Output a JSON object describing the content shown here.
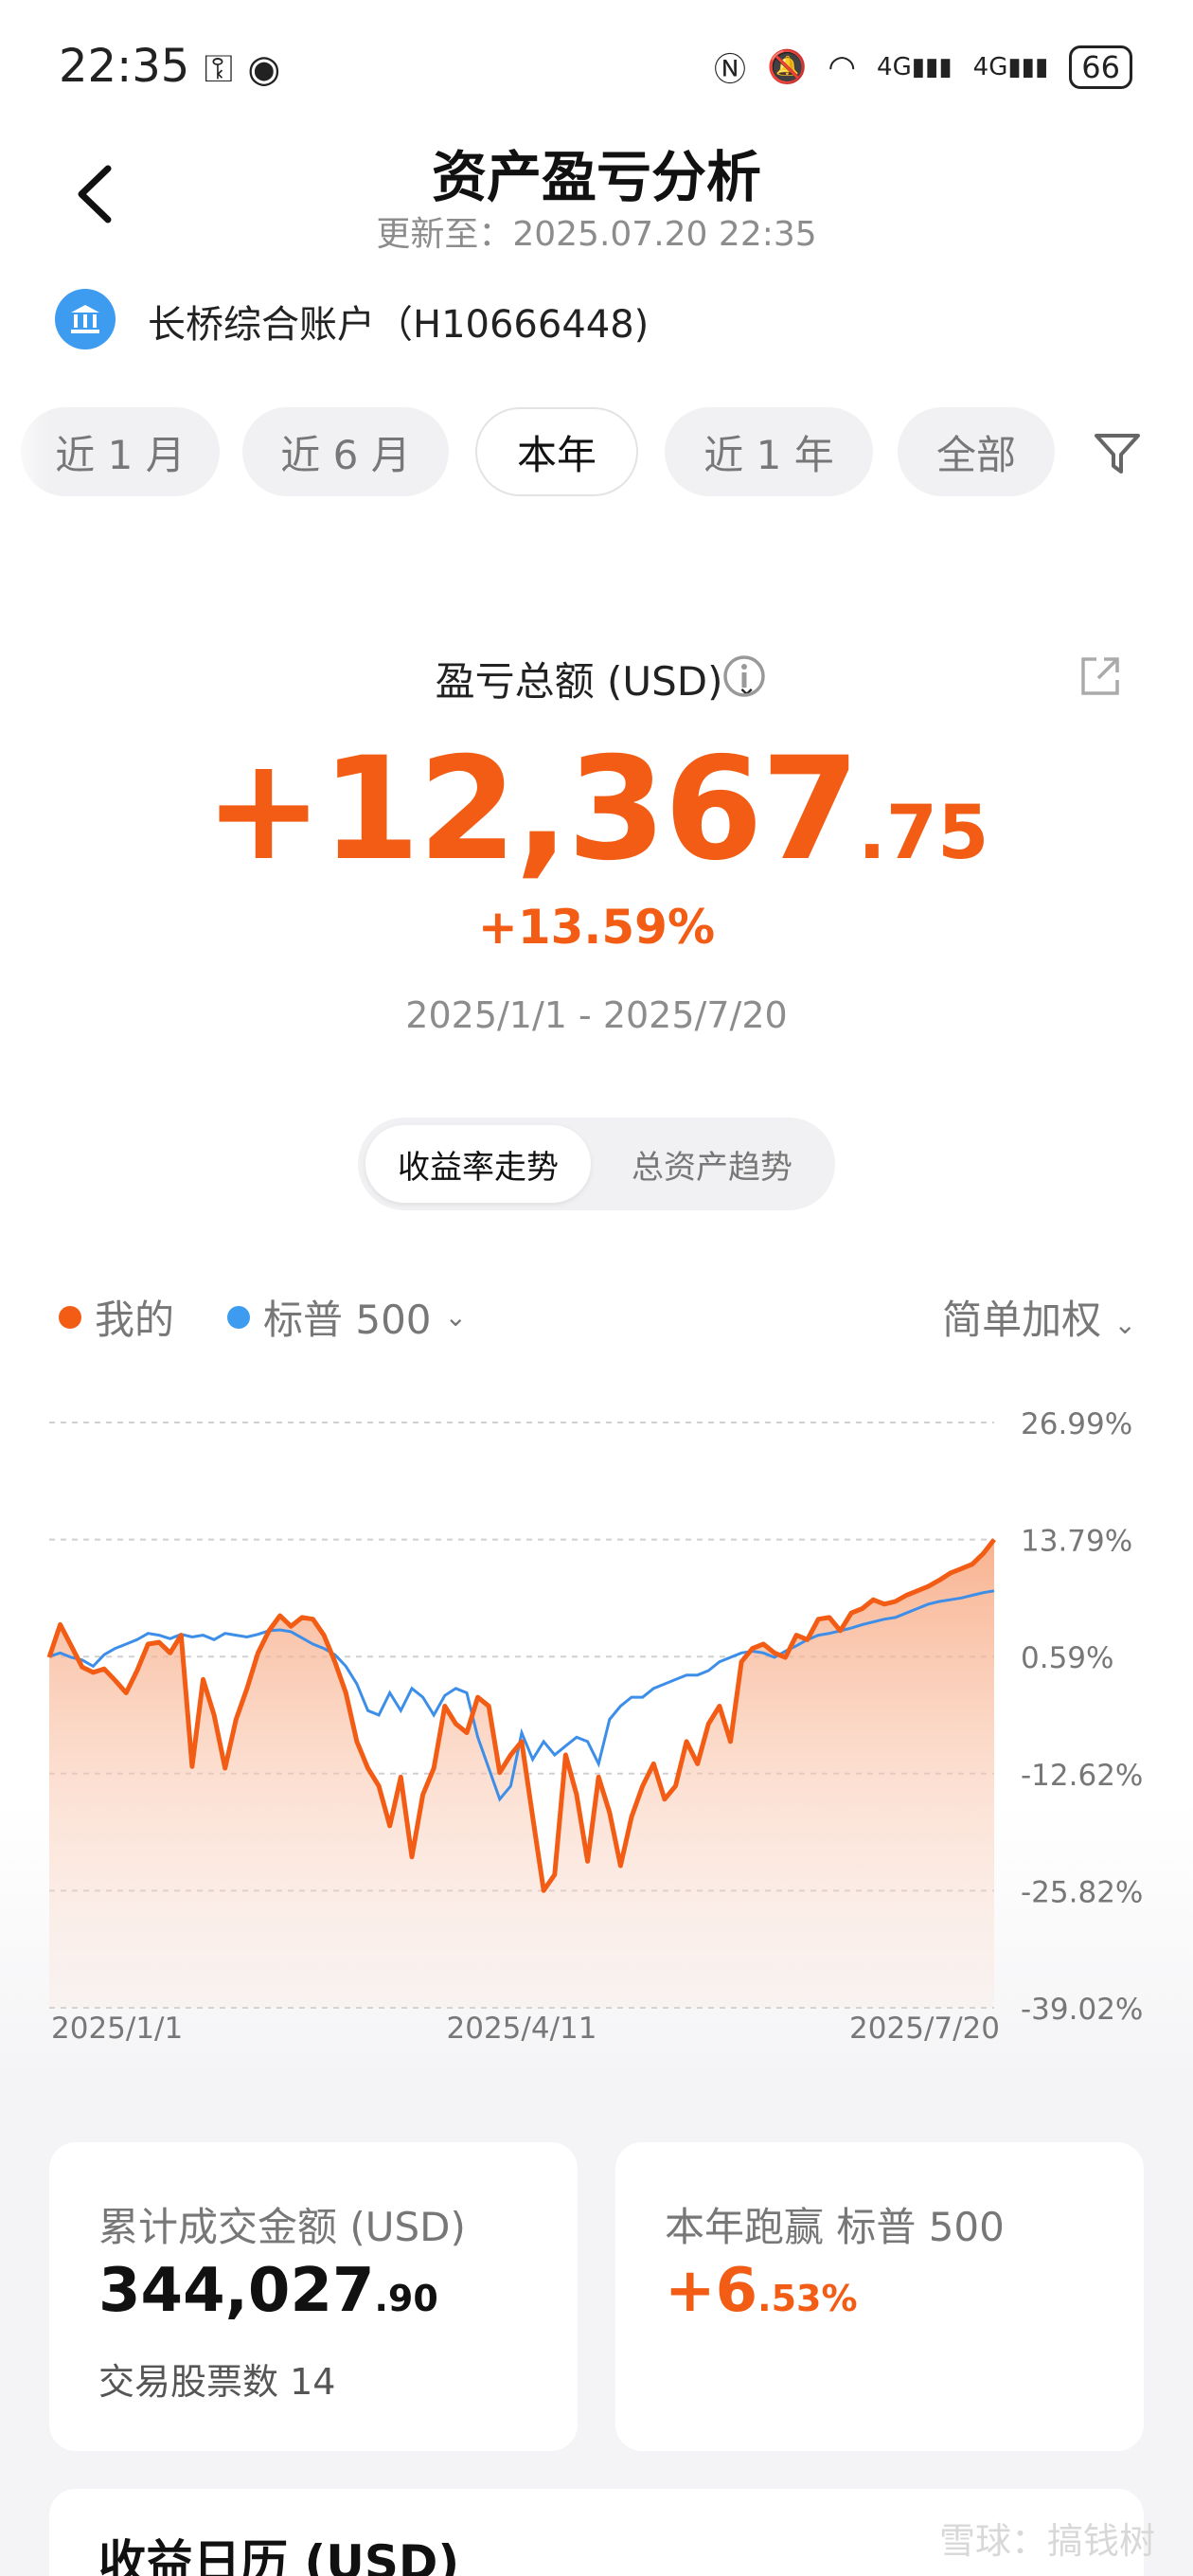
{
  "status_bar": {
    "time": "22:35",
    "icons": [
      "key-icon",
      "eye-icon",
      "nfc-icon",
      "mute-icon",
      "wifi-icon",
      "signal-4g-icon",
      "signal-4g-icon"
    ],
    "battery": "66"
  },
  "header": {
    "title": "资产盈亏分析",
    "updated": "更新至：2025.07.20 22:35"
  },
  "account": {
    "name": "长桥综合账户（H10666448)"
  },
  "period_tabs": [
    {
      "label": "近 1 月",
      "active": false
    },
    {
      "label": "近 6 月",
      "active": false
    },
    {
      "label": "本年",
      "active": true
    },
    {
      "label": "近 1 年",
      "active": false
    },
    {
      "label": "全部",
      "active": false
    }
  ],
  "summary": {
    "label": "盈亏总额 (USD)",
    "amount_int": "+12,367",
    "amount_dec": ".75",
    "percent": "+13.59%",
    "date_range": "2025/1/1 - 2025/7/20"
  },
  "chart_toggle": {
    "yield": "收益率走势",
    "assets": "总资产趋势",
    "active": "yield"
  },
  "legend": {
    "mine": "我的",
    "benchmark": "标普 500",
    "weighting": "简单加权"
  },
  "colors": {
    "accent": "#f25c14",
    "benchmark": "#3d8ee8",
    "brand_blue": "#3d9bf0"
  },
  "chart_data": {
    "type": "line",
    "ylabels": [
      "26.99%",
      "13.79%",
      "0.59%",
      "-12.62%",
      "-25.82%",
      "-39.02%"
    ],
    "ylim": [
      -39.02,
      26.99
    ],
    "xlabels": [
      "2025/1/1",
      "2025/4/11",
      "2025/7/20"
    ],
    "series": [
      {
        "name": "我的",
        "fill": true,
        "values": [
          0.5,
          4.2,
          1.8,
          -0.6,
          -1.2,
          -0.8,
          -2.1,
          -3.5,
          -1.0,
          2.0,
          2.2,
          1.0,
          3.0,
          -11.8,
          -2.0,
          -6.0,
          -12.0,
          -6.5,
          -3.0,
          1.0,
          3.5,
          5.2,
          4.0,
          5.0,
          4.8,
          3.0,
          0.0,
          -3.5,
          -9.0,
          -12.0,
          -14.0,
          -18.5,
          -13.0,
          -22.0,
          -15.0,
          -12.0,
          -5.0,
          -7.0,
          -8.0,
          -4.0,
          -5.0,
          -12.5,
          -10.5,
          -9.0,
          -17.5,
          -25.8,
          -24.0,
          -10.5,
          -15.0,
          -22.5,
          -13.0,
          -17.0,
          -23.0,
          -17.5,
          -14.0,
          -11.5,
          -15.5,
          -14.0,
          -9.0,
          -11.5,
          -7.0,
          -5.0,
          -9.0,
          0.0,
          1.5,
          2.0,
          1.0,
          0.5,
          3.0,
          2.5,
          4.8,
          5.0,
          3.5,
          5.5,
          6.0,
          7.0,
          6.5,
          6.8,
          7.5,
          8.0,
          8.5,
          9.2,
          10.0,
          10.5,
          11.0,
          12.2,
          13.79
        ]
      },
      {
        "name": "标普 500",
        "fill": false,
        "values": [
          0.6,
          1.0,
          0.5,
          0.2,
          -0.5,
          0.8,
          1.5,
          2.0,
          2.5,
          3.2,
          3.0,
          2.6,
          3.1,
          2.8,
          3.0,
          2.5,
          3.2,
          3.0,
          2.8,
          3.1,
          3.5,
          3.6,
          3.4,
          2.7,
          2.0,
          1.5,
          0.8,
          -0.5,
          -2.5,
          -5.5,
          -6.0,
          -3.5,
          -5.5,
          -3.0,
          -4.0,
          -6.0,
          -3.8,
          -3.0,
          -3.5,
          -8.5,
          -12.0,
          -15.5,
          -14.0,
          -8.0,
          -11.0,
          -9.0,
          -10.5,
          -9.5,
          -8.5,
          -9.0,
          -11.5,
          -6.5,
          -5.0,
          -4.0,
          -4.0,
          -3.0,
          -2.5,
          -2.0,
          -1.5,
          -1.5,
          -1.0,
          0.0,
          0.5,
          1.0,
          1.2,
          1.0,
          0.5,
          1.2,
          1.8,
          2.5,
          3.0,
          3.2,
          3.5,
          3.8,
          4.2,
          4.5,
          4.8,
          5.0,
          5.5,
          6.0,
          6.5,
          6.8,
          7.0,
          7.2,
          7.5,
          7.8,
          8.0
        ]
      }
    ],
    "grid": true
  },
  "cards": {
    "turnover_label": "累计成交金额 (USD)",
    "turnover_int": "344,027",
    "turnover_dec": ".90",
    "stocks_count": "交易股票数 14",
    "beat_label": "本年跑赢 标普 500",
    "beat_int": "+6",
    "beat_dec": ".53%"
  },
  "calendar": {
    "title": "收益日历 (USD)"
  },
  "watermark": "雪球：搞钱树"
}
